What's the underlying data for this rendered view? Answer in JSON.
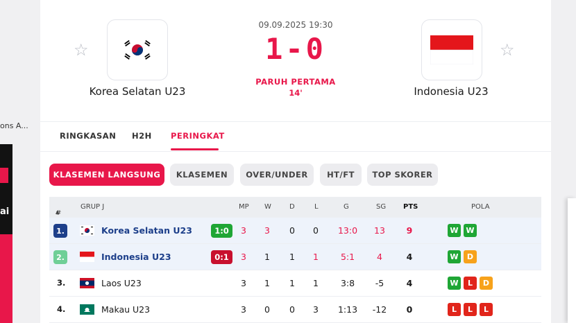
{
  "left_snippet": "ons A...",
  "left_ad_text": "ai",
  "match": {
    "date": "09.09.2025 19:30",
    "score": "1-0",
    "period": "PARUH PERTAMA",
    "minute": "14'",
    "home": {
      "name": "Korea Selatan U23",
      "flag_icon": "south-korea-flag-icon"
    },
    "away": {
      "name": "Indonesia U23",
      "flag_icon": "indonesia-flag-icon"
    }
  },
  "tabs": [
    {
      "label": "RINGKASAN",
      "active": false
    },
    {
      "label": "H2H",
      "active": false
    },
    {
      "label": "PERINGKAT",
      "active": true
    }
  ],
  "pills": [
    {
      "label": "KLASEMEN LANGSUNG",
      "active": true
    },
    {
      "label": "KLASEMEN",
      "active": false
    },
    {
      "label": "OVER/UNDER",
      "active": false
    },
    {
      "label": "HT/FT",
      "active": false
    },
    {
      "label": "TOP SKORER",
      "active": false
    }
  ],
  "table": {
    "headers": {
      "rank": "#",
      "group": "GRUP J",
      "mp": "MP",
      "w": "W",
      "d": "D",
      "l": "L",
      "g": "G",
      "sg": "SG",
      "pts": "PTS",
      "form": "POLA"
    },
    "rows": [
      {
        "rank": "1.",
        "team": "Korea Selatan U23",
        "live_score": "1:0",
        "mp": "3",
        "w": "3",
        "d": "0",
        "l": "0",
        "g": "13:0",
        "sg": "13",
        "pts": "9",
        "form": [
          "W",
          "W"
        ]
      },
      {
        "rank": "2.",
        "team": "Indonesia U23",
        "live_score": "0:1",
        "mp": "3",
        "w": "1",
        "d": "1",
        "l": "1",
        "g": "5:1",
        "sg": "4",
        "pts": "4",
        "form": [
          "W",
          "D"
        ]
      },
      {
        "rank": "3.",
        "team": "Laos U23",
        "mp": "3",
        "w": "1",
        "d": "1",
        "l": "1",
        "g": "3:8",
        "sg": "-5",
        "pts": "4",
        "form": [
          "W",
          "L",
          "D"
        ]
      },
      {
        "rank": "4.",
        "team": "Makau U23",
        "mp": "3",
        "w": "0",
        "d": "0",
        "l": "3",
        "g": "1:13",
        "sg": "-12",
        "pts": "0",
        "form": [
          "L",
          "L",
          "L"
        ]
      }
    ]
  },
  "colors": {
    "accent": "#e8174a",
    "rank1": "#1d3f8a",
    "rank2": "#6fcf97",
    "win": "#1fa635",
    "draw": "#f7a21b",
    "loss": "#e1251b",
    "live_win": "#1fa635",
    "live_loss": "#c8102e"
  }
}
